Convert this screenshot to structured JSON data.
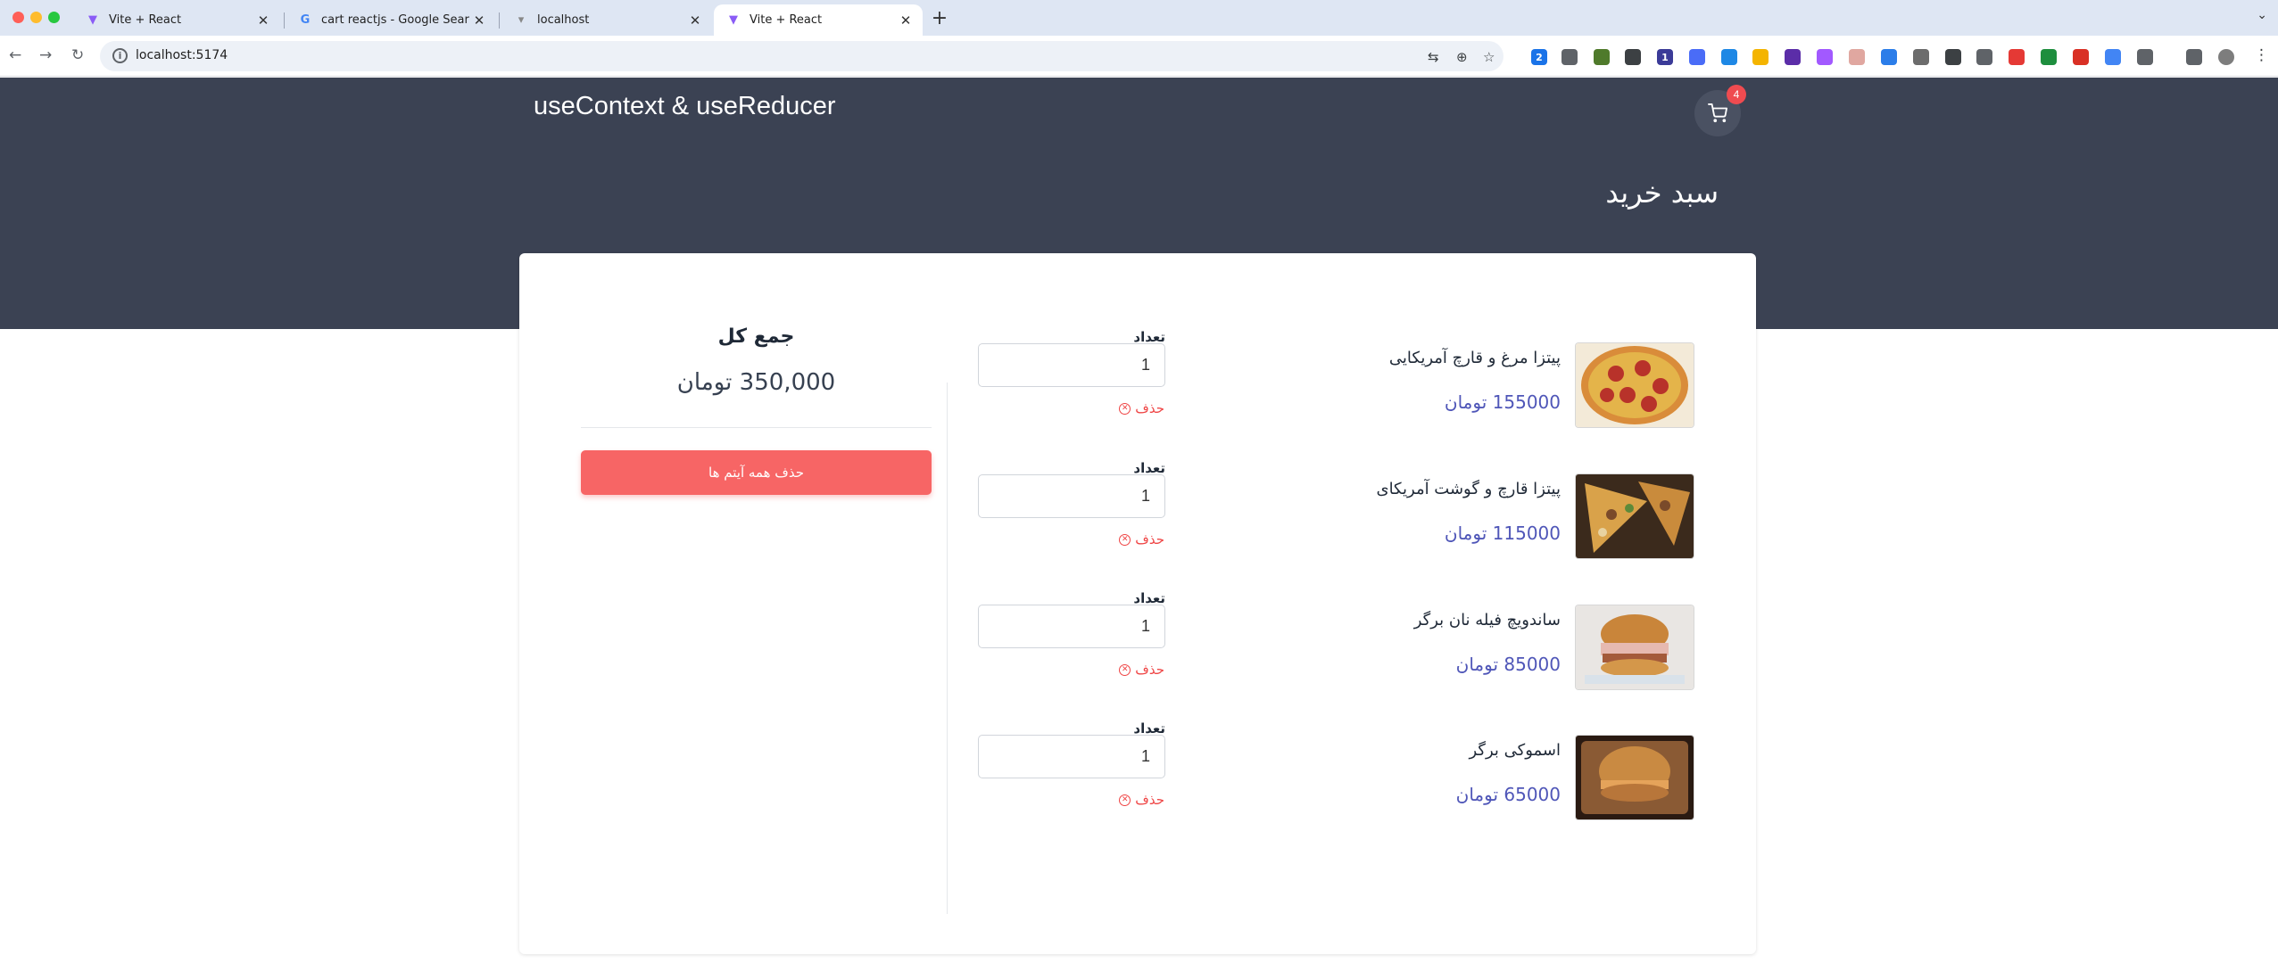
{
  "browser": {
    "tabs": [
      {
        "title": "Vite + React",
        "active": false
      },
      {
        "title": "cart reactjs - Google Search",
        "active": false
      },
      {
        "title": "localhost",
        "active": false
      },
      {
        "title": "Vite + React",
        "active": true
      }
    ],
    "url": "localhost:5174",
    "new_tab": "+",
    "extension_badges": {
      "first": "2",
      "second": "1"
    }
  },
  "header": {
    "brand": "useContext & useReducer",
    "cart_count": "4",
    "page_title": "سبد خرید"
  },
  "cart": {
    "items": [
      {
        "name": "پیتزا مرغ و قارچ آمریکایی",
        "price": "155000 تومان",
        "qty_label": "تعداد",
        "qty": "1",
        "remove_label": "حذف",
        "image": "pepperoni-pizza"
      },
      {
        "name": "پیتزا قارچ و گوشت آمریکای",
        "price": "115000 تومان",
        "qty_label": "تعداد",
        "qty": "1",
        "remove_label": "حذف",
        "image": "mushroom-meat-pizza"
      },
      {
        "name": "ساندویچ فیله نان برگر",
        "price": "85000 تومان",
        "qty_label": "تعداد",
        "qty": "1",
        "remove_label": "حذف",
        "image": "fillet-burger"
      },
      {
        "name": "اسموکی برگر",
        "price": "65000 تومان",
        "qty_label": "تعداد",
        "qty": "1",
        "remove_label": "حذف",
        "image": "smoky-burger"
      }
    ],
    "total_label": "جمع کل",
    "total_value": "350,000 تومان",
    "clear_all_label": "حذف همه آیتم ها"
  },
  "colors": {
    "header_bg": "#3b4253",
    "price_color": "#4f56b8",
    "remove_color": "#ef4444",
    "clear_button_bg": "#f76565",
    "badge_bg": "#ef4b50"
  }
}
